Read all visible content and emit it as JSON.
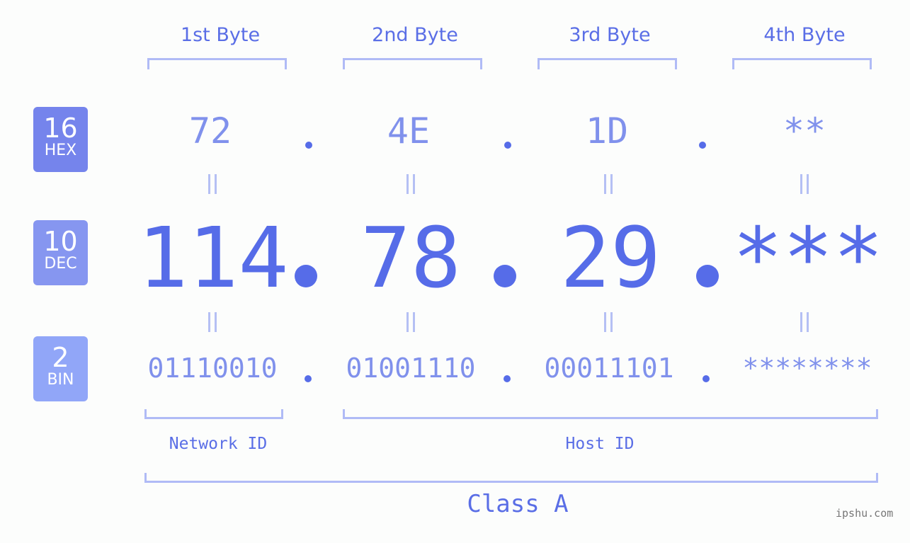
{
  "bytes": [
    {
      "label": "1st Byte",
      "hex": "72",
      "dec": "114",
      "bin": "01110010"
    },
    {
      "label": "2nd Byte",
      "hex": "4E",
      "dec": "78",
      "bin": "01001110"
    },
    {
      "label": "3rd Byte",
      "hex": "1D",
      "dec": "29",
      "bin": "00011101"
    },
    {
      "label": "4th Byte",
      "hex": "**",
      "dec": "***",
      "bin": "********"
    }
  ],
  "badges": {
    "hex": {
      "num": "16",
      "label": "HEX",
      "color": "#7584ec"
    },
    "dec": {
      "num": "10",
      "label": "DEC",
      "color": "#8696f0"
    },
    "bin": {
      "num": "2",
      "label": "BIN",
      "color": "#91a6f8"
    }
  },
  "equals_symbol": "=",
  "network_id_label": "Network ID",
  "host_id_label": "Host ID",
  "class_label": "Class A",
  "watermark": "ipshu.com",
  "colors": {
    "accent": "#566ce8",
    "light": "#8091ec",
    "bracket": "#b0bbf6",
    "background": "#fcfdfc"
  }
}
